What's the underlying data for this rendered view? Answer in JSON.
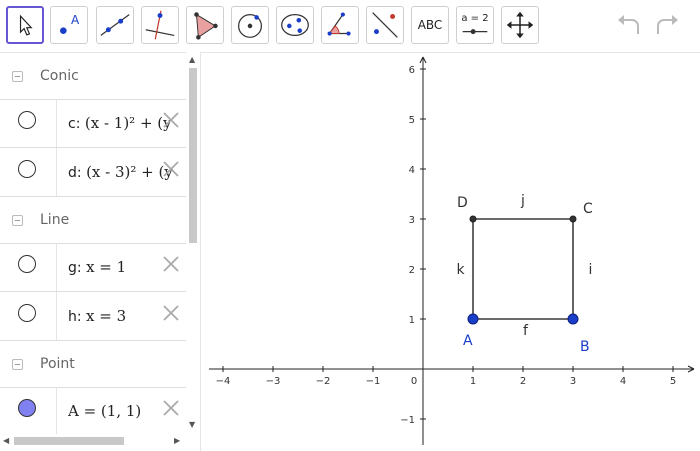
{
  "toolbar": {
    "tools": [
      {
        "name": "move-tool"
      },
      {
        "name": "point-tool",
        "label": "A"
      },
      {
        "name": "line-tool"
      },
      {
        "name": "perpendicular-line-tool"
      },
      {
        "name": "polygon-tool"
      },
      {
        "name": "circle-center-point-tool"
      },
      {
        "name": "conic-through-five-points-tool"
      },
      {
        "name": "angle-tool"
      },
      {
        "name": "reflect-about-line-tool"
      },
      {
        "name": "text-tool",
        "label": "ABC"
      },
      {
        "name": "slider-tool",
        "label": "a = 2"
      },
      {
        "name": "move-graphics-view-tool"
      }
    ],
    "undo_icon": "undo-icon",
    "redo_icon": "redo-icon"
  },
  "algebra": {
    "groups": [
      {
        "name": "Conic",
        "items": [
          {
            "name": "c",
            "expr": "(x - 1)² + (y",
            "filled": false
          },
          {
            "name": "d",
            "expr": "(x - 3)² + (y",
            "filled": false
          }
        ]
      },
      {
        "name": "Line",
        "items": [
          {
            "name": "g",
            "expr": "x = 1",
            "filled": false
          },
          {
            "name": "h",
            "expr": "x = 3",
            "filled": false
          }
        ]
      },
      {
        "name": "Point",
        "items": [
          {
            "name": "A",
            "expr": "A = (1, 1)",
            "filled": true
          }
        ]
      }
    ]
  },
  "graphics": {
    "x_ticks": [
      "−4",
      "−3",
      "−2",
      "−1",
      "0",
      "1",
      "2",
      "3",
      "4",
      "5"
    ],
    "y_ticks": [
      "6",
      "5",
      "4",
      "3",
      "2",
      "1",
      "−1"
    ],
    "points": [
      {
        "label": "A",
        "x": 1,
        "y": 1,
        "style": "free"
      },
      {
        "label": "B",
        "x": 3,
        "y": 1,
        "style": "free"
      },
      {
        "label": "C",
        "x": 3,
        "y": 3,
        "style": "dependent"
      },
      {
        "label": "D",
        "x": 1,
        "y": 3,
        "style": "dependent"
      }
    ],
    "segments": [
      "f",
      "i",
      "j",
      "k"
    ],
    "colors": {
      "free_point": "#1a3ec8",
      "dependent_point": "#333333",
      "segment": "#555555",
      "axis": "#222222"
    }
  }
}
